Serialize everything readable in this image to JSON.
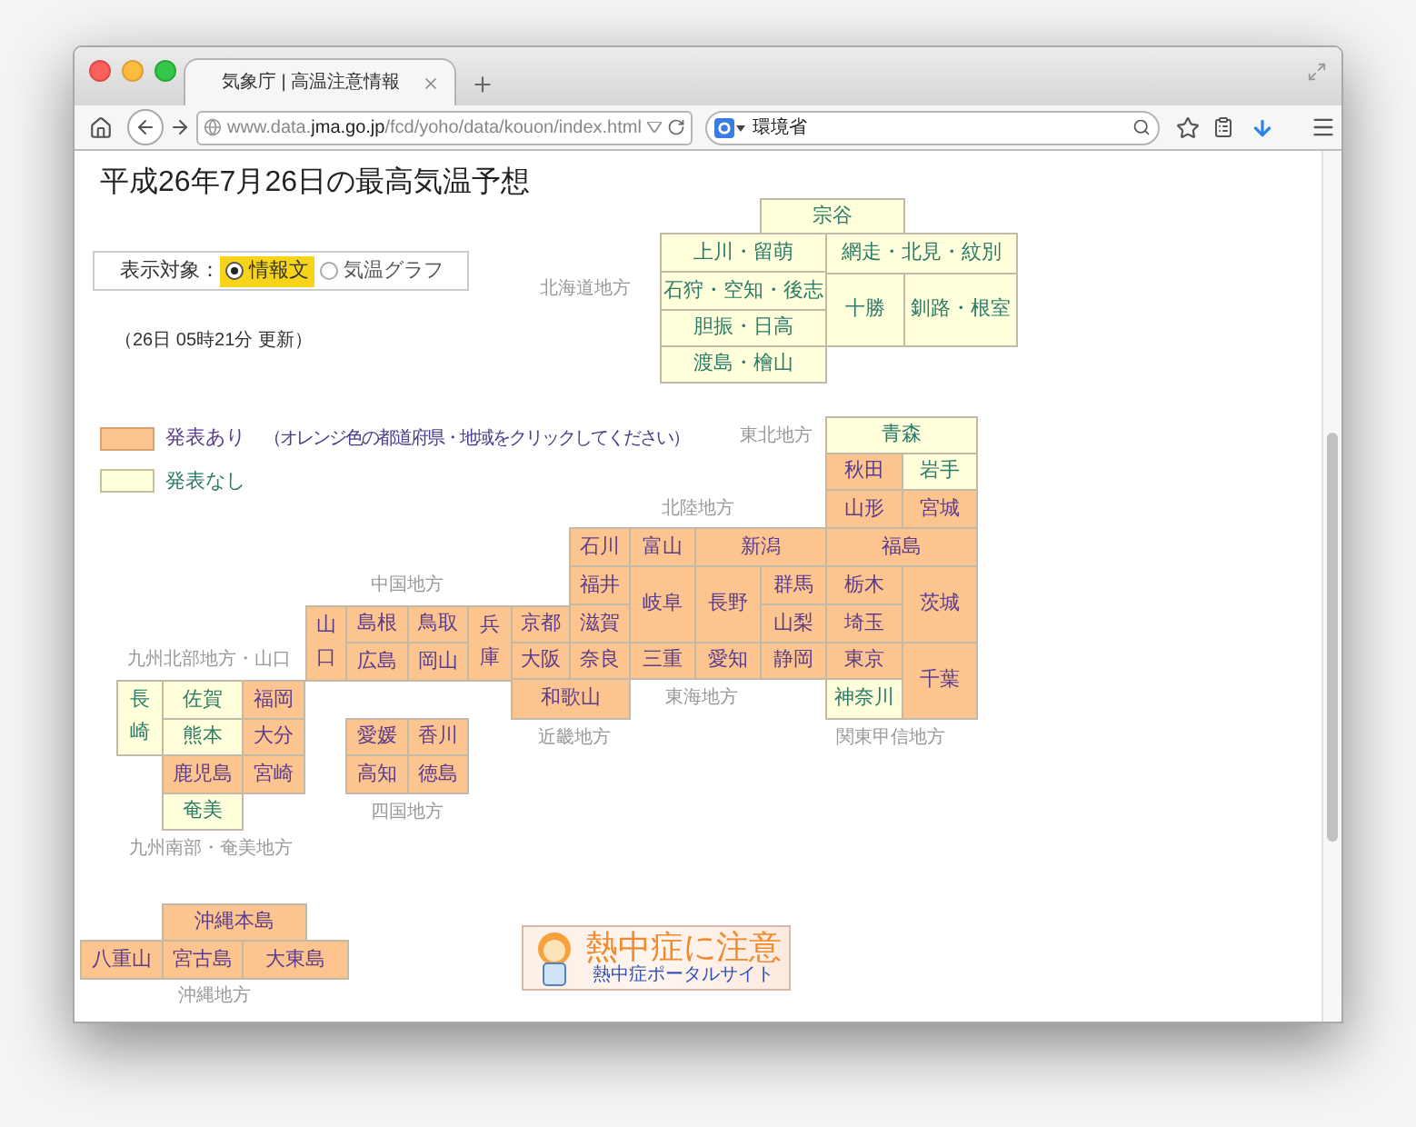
{
  "browser": {
    "tab_title": "気象庁 | 高温注意情報",
    "url": "www.data.**jma.go.jp**/fcd/yoho/data/kouon/index.html",
    "search_value": "環境省"
  },
  "page": {
    "title": "平成26年7月26日の最高気温予想",
    "display_selector": {
      "label": "表示対象：",
      "options": [
        {
          "label": "情報文",
          "selected": true
        },
        {
          "label": "気温グラフ",
          "selected": false
        }
      ]
    },
    "updated": "（26日 05時21分 更新）",
    "legend": [
      {
        "label": "発表あり",
        "issued": true
      },
      {
        "label": "発表なし",
        "issued": false
      }
    ],
    "legend_note": "（オレンジ色の都道府県・地域をクリックしてください）",
    "region_labels": [
      "北海道地方",
      "東北地方",
      "北陸地方",
      "中国地方",
      "九州北部地方・山口",
      "東海地方",
      "近畿地方",
      "関東甲信地方",
      "四国地方",
      "九州南部・奄美地方",
      "沖縄地方"
    ],
    "cells": [
      {
        "name": "宗谷",
        "issued": false
      },
      {
        "name": "上川・留萌",
        "issued": false
      },
      {
        "name": "網走・北見・紋別",
        "issued": false
      },
      {
        "name": "石狩・空知・後志",
        "issued": false
      },
      {
        "name": "十勝",
        "issued": false
      },
      {
        "name": "釧路・根室",
        "issued": false
      },
      {
        "name": "胆振・日高",
        "issued": false
      },
      {
        "name": "渡島・檜山",
        "issued": false
      },
      {
        "name": "青森",
        "issued": false
      },
      {
        "name": "秋田",
        "issued": true
      },
      {
        "name": "岩手",
        "issued": false
      },
      {
        "name": "山形",
        "issued": true
      },
      {
        "name": "宮城",
        "issued": true
      },
      {
        "name": "石川",
        "issued": true
      },
      {
        "name": "富山",
        "issued": true
      },
      {
        "name": "新潟",
        "issued": true
      },
      {
        "name": "福島",
        "issued": true
      },
      {
        "name": "福井",
        "issued": true
      },
      {
        "name": "岐阜",
        "issued": true
      },
      {
        "name": "長野",
        "issued": true
      },
      {
        "name": "群馬",
        "issued": true
      },
      {
        "name": "栃木",
        "issued": true
      },
      {
        "name": "茨城",
        "issued": true
      },
      {
        "name": "滋賀",
        "issued": true
      },
      {
        "name": "山梨",
        "issued": true
      },
      {
        "name": "埼玉",
        "issued": true
      },
      {
        "name": "奈良",
        "issued": true
      },
      {
        "name": "三重",
        "issued": true
      },
      {
        "name": "愛知",
        "issued": true
      },
      {
        "name": "静岡",
        "issued": true
      },
      {
        "name": "東京",
        "issued": true
      },
      {
        "name": "千葉",
        "issued": true
      },
      {
        "name": "和歌山",
        "issued": true
      },
      {
        "name": "神奈川",
        "issued": false
      },
      {
        "name": "山口",
        "issued": true
      },
      {
        "name": "島根",
        "issued": true
      },
      {
        "name": "鳥取",
        "issued": true
      },
      {
        "name": "兵庫",
        "issued": true
      },
      {
        "name": "京都",
        "issued": true
      },
      {
        "name": "広島",
        "issued": true
      },
      {
        "name": "岡山",
        "issued": true
      },
      {
        "name": "大阪",
        "issued": true
      },
      {
        "name": "長崎",
        "issued": false
      },
      {
        "name": "佐賀",
        "issued": false
      },
      {
        "name": "福岡",
        "issued": true
      },
      {
        "name": "熊本",
        "issued": false
      },
      {
        "name": "大分",
        "issued": true
      },
      {
        "name": "鹿児島",
        "issued": true
      },
      {
        "name": "宮崎",
        "issued": true
      },
      {
        "name": "奄美",
        "issued": false
      },
      {
        "name": "愛媛",
        "issued": true
      },
      {
        "name": "香川",
        "issued": true
      },
      {
        "name": "高知",
        "issued": true
      },
      {
        "name": "徳島",
        "issued": true
      },
      {
        "name": "沖縄本島",
        "issued": true
      },
      {
        "name": "八重山",
        "issued": true
      },
      {
        "name": "宮古島",
        "issued": true
      },
      {
        "name": "大東島",
        "issued": true
      }
    ],
    "banner": {
      "title": "熱中症に注意",
      "subtitle": "熱中症ポータルサイト"
    }
  }
}
